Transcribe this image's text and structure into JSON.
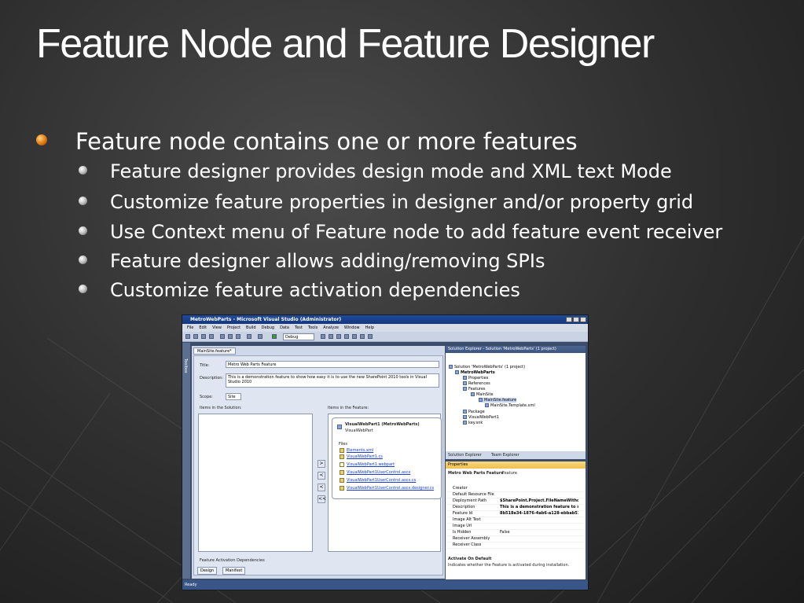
{
  "slide": {
    "title": "Feature Node and Feature Designer",
    "bullet": "Feature node contains one or more features",
    "subbullets": [
      "Feature designer provides design mode and XML text Mode",
      "Customize feature properties in designer and/or property grid",
      "Use Context menu of Feature node to add feature event receiver",
      "Feature designer allows adding/removing SPIs",
      "Customize feature activation dependencies"
    ]
  },
  "vs": {
    "window_title": "MetroWebParts - Microsoft Visual Studio (Administrator)",
    "menu": [
      "File",
      "Edit",
      "View",
      "Project",
      "Build",
      "Debug",
      "Data",
      "Test",
      "Tools",
      "Analyze",
      "Window",
      "Help"
    ],
    "config": "Debug",
    "toolbox_label": "Toolbox",
    "doc_tab": "MainSite.feature*",
    "title_label": "Title:",
    "title_value": "Metro Web Parts Feature",
    "description_label": "Description:",
    "description_value": "This is a demonstration feature to show how easy it is to use the new SharePoint 2010 tools in Visual Studio 2010",
    "scope_label": "Scope:",
    "scope_value": "Site",
    "items_solution": "Items in the Solution:",
    "items_feature": "Items in the Feature:",
    "card_title": "VisualWebPart1 (MetroWebParts)",
    "card_subtitle": "VisualWebPart",
    "files_label": "Files",
    "files": [
      "Elements.xml",
      "VisualWebPart1.cs",
      "VisualWebPart1.webpart",
      "VisualWebPart1UserControl.ascx",
      "VisualWebPart1UserControl.ascx.cs",
      "VisualWebPart1UserControl.ascx.designer.cs"
    ],
    "arrow_buttons": [
      ">",
      "<",
      "<",
      ">>",
      "<<"
    ],
    "activation_deps": "Feature Activation Dependencies",
    "tab_design": "Design",
    "tab_manifest": "Manifest",
    "status": "Ready",
    "solution_explorer_title": "Solution Explorer - Solution 'MetroWebParts' (1 project)",
    "tree": [
      "Solution 'MetroWebParts' (1 project)",
      "MetroWebParts",
      "Properties",
      "References",
      "Features",
      "MainSite",
      "MainSite.feature",
      "MainSite.Template.xml",
      "Package",
      "VisualWebPart1",
      "key.snk"
    ],
    "se_tab1": "Solution Explorer",
    "se_tab2": "Team Explorer",
    "properties_title": "Properties",
    "properties_object": "Metro Web Parts Feature",
    "properties_object_type": "Feature",
    "properties": [
      {
        "k": "Creator",
        "v": ""
      },
      {
        "k": "Default Resource File",
        "v": ""
      },
      {
        "k": "Deployment Path",
        "v": "$SharePoint.Project.FileNameWithout"
      },
      {
        "k": "Description",
        "v": "This is a demonstration feature to sho"
      },
      {
        "k": "Feature Id",
        "v": "8b518e34-1876-4ab6-a128-ebbab51"
      },
      {
        "k": "Image Alt Text",
        "v": ""
      },
      {
        "k": "Image Url",
        "v": ""
      },
      {
        "k": "Is Hidden",
        "v": "False"
      },
      {
        "k": "Receiver Assembly",
        "v": ""
      },
      {
        "k": "Receiver Class",
        "v": ""
      }
    ],
    "help_title": "Activate On Default",
    "help_text": "Indicates whether the Feature is activated during installation."
  }
}
